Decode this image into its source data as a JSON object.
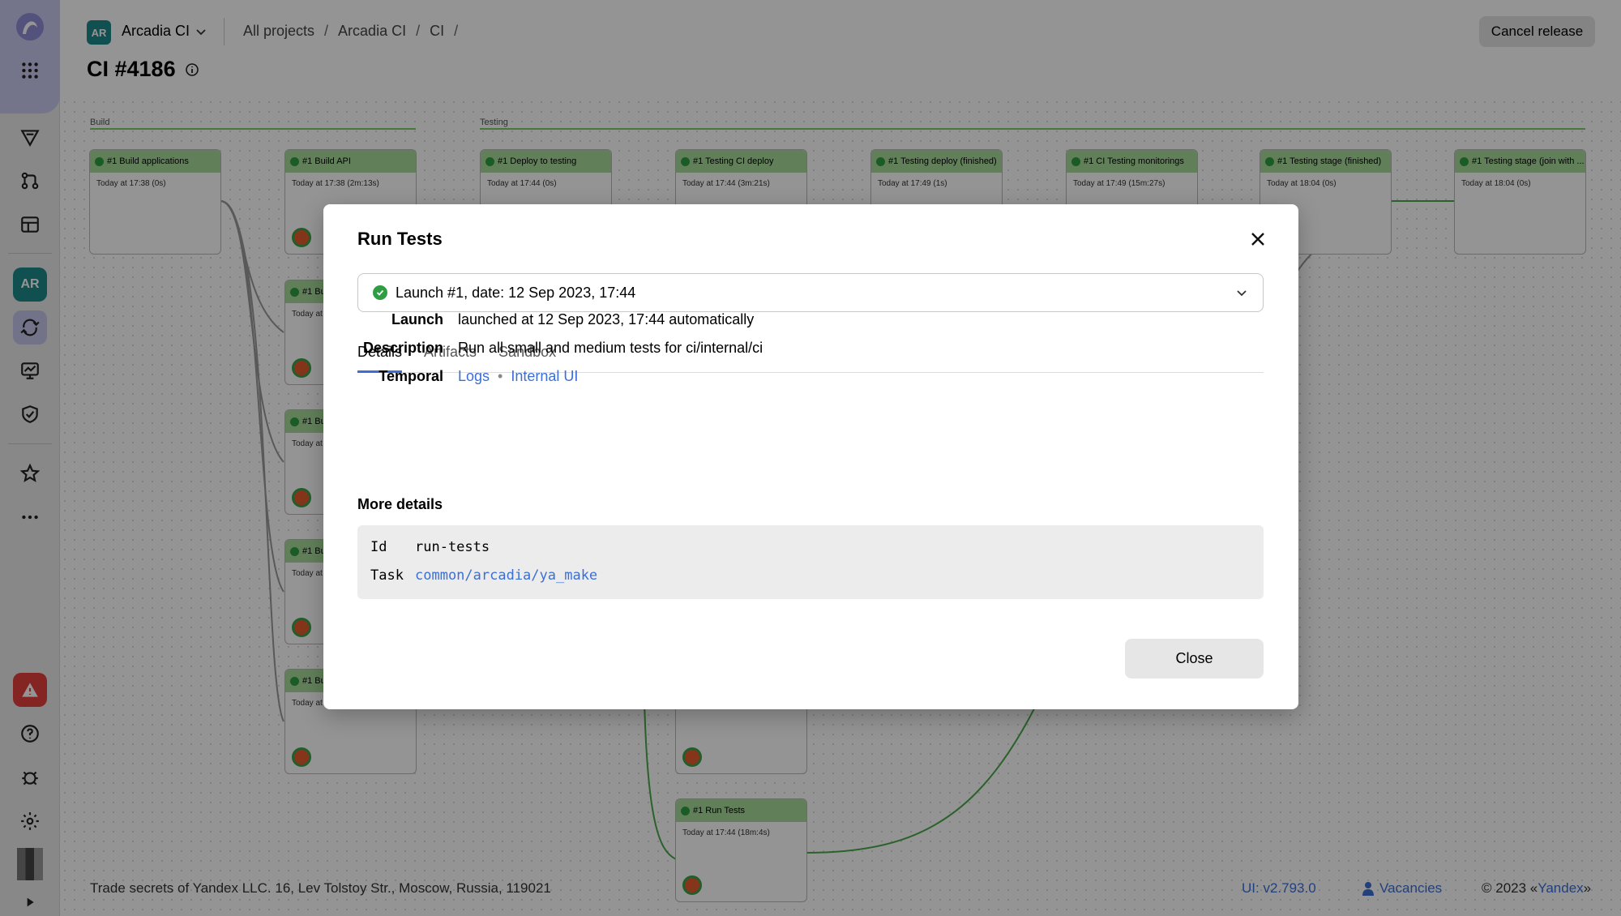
{
  "sidebar": {
    "items": [
      {
        "name": "apps-icon"
      },
      {
        "name": "arrow-icon"
      },
      {
        "name": "pull-requests-icon"
      },
      {
        "name": "layout-icon"
      },
      {
        "name": "project-ar-badge",
        "label": "AR"
      },
      {
        "name": "ci-icon"
      },
      {
        "name": "monitor-icon"
      },
      {
        "name": "shield-icon"
      },
      {
        "name": "star-icon"
      },
      {
        "name": "more-icon"
      },
      {
        "name": "alert-icon"
      },
      {
        "name": "help-icon"
      },
      {
        "name": "bug-icon"
      },
      {
        "name": "settings-icon"
      },
      {
        "name": "user-avatar"
      },
      {
        "name": "expand-icon"
      }
    ]
  },
  "header": {
    "project_badge": "AR",
    "project_name": "Arcadia CI",
    "breadcrumbs": [
      "All projects",
      "Arcadia CI",
      "CI"
    ],
    "cancel_label": "Cancel release",
    "title": "CI #4186"
  },
  "graph": {
    "stages": [
      "Build",
      "Testing"
    ],
    "nodes": [
      {
        "title": "#1 Build applications",
        "time": "Today at 17:38 (0s)"
      },
      {
        "title": "#1 Build API",
        "time": "Today at 17:38 (2m:13s)"
      },
      {
        "title": "#1 Deploy to testing",
        "time": "Today at 17:44 (0s)"
      },
      {
        "title": "#1 Testing CI deploy",
        "time": "Today at 17:44 (3m:21s)"
      },
      {
        "title": "#1 Testing deploy (finished)",
        "time": "Today at 17:49 (1s)"
      },
      {
        "title": "#1 CI Testing monitorings",
        "time": "Today at 17:49 (15m:27s)"
      },
      {
        "title": "#1 Testing stage (finished)",
        "time": "Today at 18:04 (0s)"
      },
      {
        "title": "#1 Testing stage (join with ...",
        "time": "Today at 18:04 (0s)"
      },
      {
        "title": "#1 Run Tests",
        "time": "Today at 17:44 (18m:4s)"
      }
    ],
    "partial_title": "#1 Bu",
    "partial_time": "Today at"
  },
  "footer": {
    "left": "Trade secrets of Yandex LLC. 16, Lev Tolstoy Str., Moscow, Russia, 119021",
    "version": "UI: v2.793.0",
    "vacancies": "Vacancies",
    "copyright_prefix": "© 2023 «",
    "copyright_link": "Yandex",
    "copyright_suffix": "»"
  },
  "modal": {
    "title": "Run Tests",
    "launch_select": "Launch #1, date: 12 Sep 2023, 17:44",
    "tabs": [
      "Details",
      "Artifacts",
      "Sandbox"
    ],
    "active_tab": "Details",
    "launch_label": "Launch",
    "launch_value": "launched at 12 Sep 2023, 17:44 automatically",
    "description_label": "Description",
    "description_value": "Run all small and medium tests for ci/internal/ci",
    "temporal_label": "Temporal",
    "temporal_logs": "Logs",
    "temporal_internal": "Internal UI",
    "more_details": "More details",
    "details": [
      {
        "key": "Id",
        "value": "run-tests"
      },
      {
        "key": "Task",
        "value": "common/arcadia/ya_make"
      }
    ],
    "close_label": "Close"
  },
  "colors": {
    "accent": "#3b6fd6",
    "success": "#2f9d43",
    "project": "#1e8b8b",
    "danger": "#e3403d"
  }
}
